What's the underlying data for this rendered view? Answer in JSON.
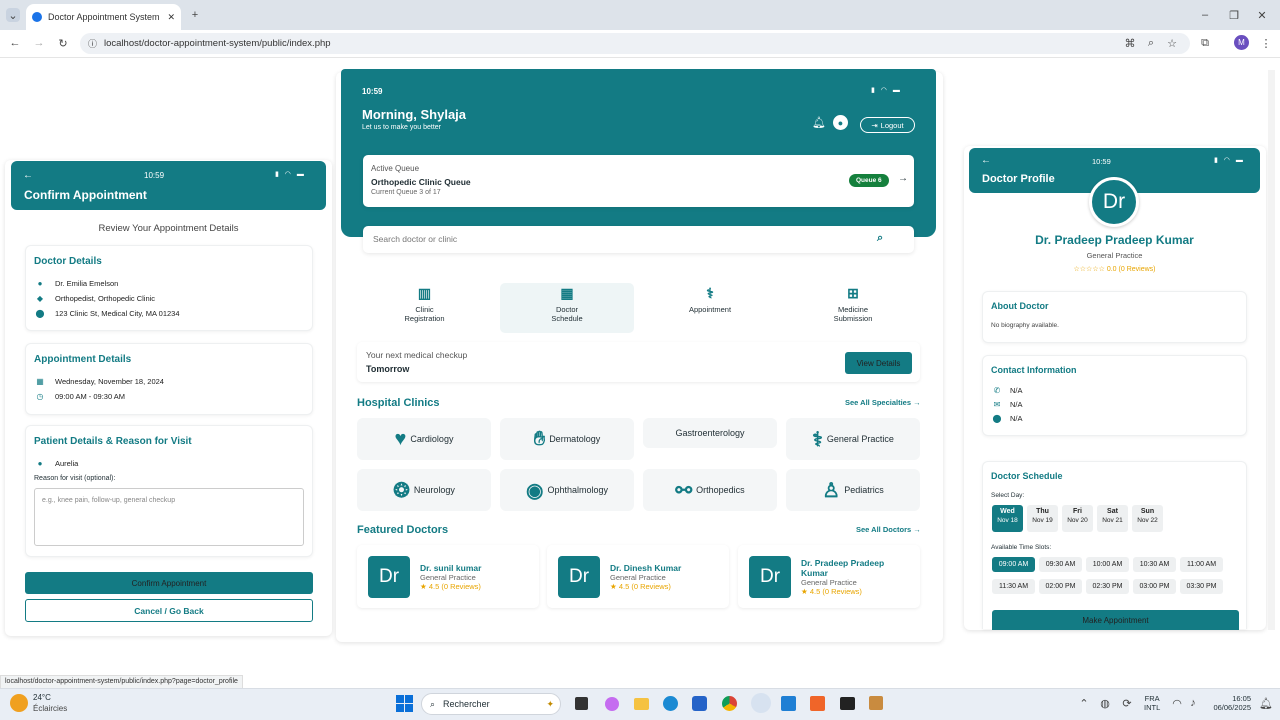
{
  "browser": {
    "tab_title": "Doctor Appointment System - F",
    "url": "localhost/doctor-appointment-system/public/index.php",
    "status_url": "localhost/doctor-appointment-system/public/index.php?page=doctor_profile",
    "profile_initial": "M"
  },
  "left": {
    "time": "10:59",
    "title": "Confirm Appointment",
    "review_heading": "Review Your Appointment Details",
    "doctor_section": "Doctor Details",
    "doctor_name": "Dr. Emilia Emelson",
    "doctor_specialty": "Orthopedist, Orthopedic Clinic",
    "doctor_address": "123 Clinic St, Medical City, MA 01234",
    "appt_section": "Appointment Details",
    "appt_date": "Wednesday, November 18, 2024",
    "appt_time": "09:00 AM - 09:30 AM",
    "patient_section": "Patient Details & Reason for Visit",
    "patient_name": "Aurelia",
    "reason_label": "Reason for visit (optional):",
    "reason_placeholder": "e.g., knee pain, follow-up, general checkup",
    "confirm_label": "Confirm Appointment",
    "cancel_label": "Cancel / Go Back"
  },
  "center": {
    "time": "10:59",
    "greeting": "Morning, Shylaja",
    "subgreeting": "Let us to make you better",
    "logout_label": "Logout",
    "queue_label": "Active Queue",
    "queue_name": "Orthopedic Clinic Queue",
    "queue_info": "Current Queue 3 of 17",
    "queue_badge": "Queue 6",
    "search_placeholder": "Search doctor or clinic",
    "menu": [
      {
        "label1": "Clinic",
        "label2": "Registration"
      },
      {
        "label1": "Doctor",
        "label2": "Schedule"
      },
      {
        "label1": "Appointment",
        "label2": ""
      },
      {
        "label1": "Medicine",
        "label2": "Submission"
      }
    ],
    "checkup_label": "Your next medical checkup",
    "checkup_when": "Tomorrow",
    "view_details": "View Details",
    "clinics_title": "Hospital Clinics",
    "see_all_specialties": "See All Specialties →",
    "clinics": [
      "Cardiology",
      "Dermatology",
      "Gastroenterology",
      "General Practice",
      "Neurology",
      "Ophthalmology",
      "Orthopedics",
      "Pediatrics"
    ],
    "featured_title": "Featured Doctors",
    "see_all_doctors": "See All Doctors →",
    "doctors": [
      {
        "initials": "Dr",
        "name": "Dr. sunil kumar",
        "specialty": "General Practice",
        "rating": "4.5 (0 Reviews)"
      },
      {
        "initials": "Dr",
        "name": "Dr. Dinesh Kumar",
        "specialty": "General Practice",
        "rating": "4.5 (0 Reviews)"
      },
      {
        "initials": "Dr",
        "name": "Dr. Pradeep Pradeep Kumar",
        "specialty": "General Practice",
        "rating": "4.5 (0 Reviews)"
      }
    ]
  },
  "right": {
    "time": "10:59",
    "title": "Doctor Profile",
    "avatar": "Dr",
    "name": "Dr. Pradeep Pradeep Kumar",
    "specialty": "General Practice",
    "rating": "0.0 (0 Reviews)",
    "about_title": "About Doctor",
    "about_text": "No biography available.",
    "contact_title": "Contact Information",
    "phone": "N/A",
    "email": "N/A",
    "location": "N/A",
    "schedule_title": "Doctor Schedule",
    "select_day": "Select Day:",
    "days": [
      {
        "d": "Wed",
        "date": "Nov 18"
      },
      {
        "d": "Thu",
        "date": "Nov 19"
      },
      {
        "d": "Fri",
        "date": "Nov 20"
      },
      {
        "d": "Sat",
        "date": "Nov 21"
      },
      {
        "d": "Sun",
        "date": "Nov 22"
      }
    ],
    "slots_label": "Available Time Slots:",
    "slots": [
      "09:00 AM",
      "09:30 AM",
      "10:00 AM",
      "10:30 AM",
      "11:00 AM",
      "11:30 AM",
      "02:00 PM",
      "02:30 PM",
      "03:00 PM",
      "03:30 PM"
    ],
    "make_appointment": "Make Appointment"
  },
  "taskbar": {
    "temp": "24°C",
    "weather": "Éclaircies",
    "search": "Rechercher",
    "lang1": "FRA",
    "lang2": "INTL",
    "clock_time": "16:05",
    "clock_date": "06/06/2025"
  }
}
